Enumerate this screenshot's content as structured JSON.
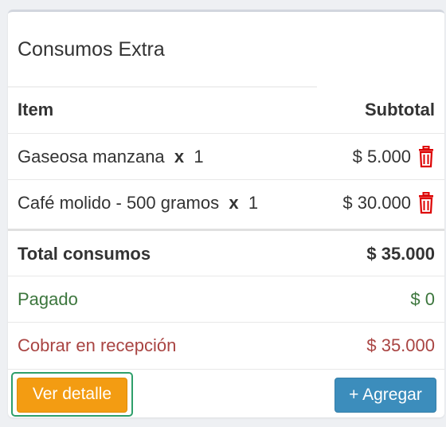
{
  "panel": {
    "title": "Consumos Extra",
    "columns": {
      "item": "Item",
      "subtotal": "Subtotal"
    },
    "items": [
      {
        "name": "Gaseosa manzana",
        "qty_sep": "x",
        "qty": "1",
        "subtotal": "$ 5.000"
      },
      {
        "name": "Café molido - 500 gramos",
        "qty_sep": "x",
        "qty": "1",
        "subtotal": "$ 30.000"
      }
    ],
    "total": {
      "label": "Total consumos",
      "value": "$ 35.000"
    },
    "paid": {
      "label": "Pagado",
      "value": "$ 0"
    },
    "due": {
      "label": "Cobrar en recepción",
      "value": "$ 35.000"
    },
    "buttons": {
      "detail": "Ver detalle",
      "add": "+ Agregar"
    }
  },
  "colors": {
    "paid": "#3c763d",
    "due": "#a94442",
    "trash": "#dd0000",
    "detail_button": "#f39c12",
    "add_button": "#3c8dbc"
  },
  "icons": {
    "delete": "trash-icon"
  }
}
